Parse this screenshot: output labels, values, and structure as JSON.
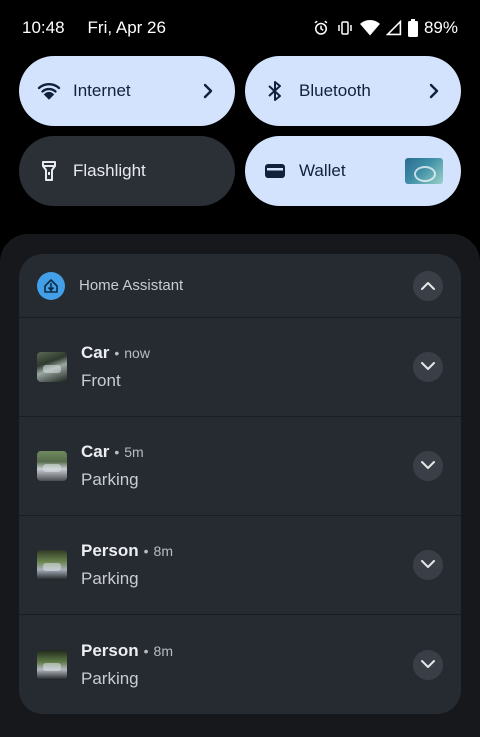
{
  "status_bar": {
    "time": "10:48",
    "date": "Fri, Apr 26",
    "battery": "89%",
    "icons": [
      "alarm-icon",
      "vibrate-icon",
      "wifi-icon",
      "signal-icon",
      "battery-icon"
    ]
  },
  "quick_tiles": [
    {
      "label": "Internet",
      "state": "on",
      "icon": "wifi-icon",
      "has_chevron": true
    },
    {
      "label": "Bluetooth",
      "state": "on",
      "icon": "bluetooth-icon",
      "has_chevron": true
    },
    {
      "label": "Flashlight",
      "state": "off",
      "icon": "flashlight-icon",
      "has_chevron": false
    },
    {
      "label": "Wallet",
      "state": "on",
      "icon": "wallet-icon",
      "has_chevron": false
    }
  ],
  "notification_group": {
    "app_name": "Home Assistant",
    "notifications": [
      {
        "title": "Car",
        "time": "now",
        "body": "Front"
      },
      {
        "title": "Car",
        "time": "5m",
        "body": "Parking"
      },
      {
        "title": "Person",
        "time": "8m",
        "body": "Parking"
      },
      {
        "title": "Person",
        "time": "8m",
        "body": "Parking"
      }
    ]
  },
  "colors": {
    "tile_on": "#d3e3fd",
    "tile_off": "#2b2f36",
    "app_icon": "#43a0e8",
    "notification_card": "#262a31"
  }
}
